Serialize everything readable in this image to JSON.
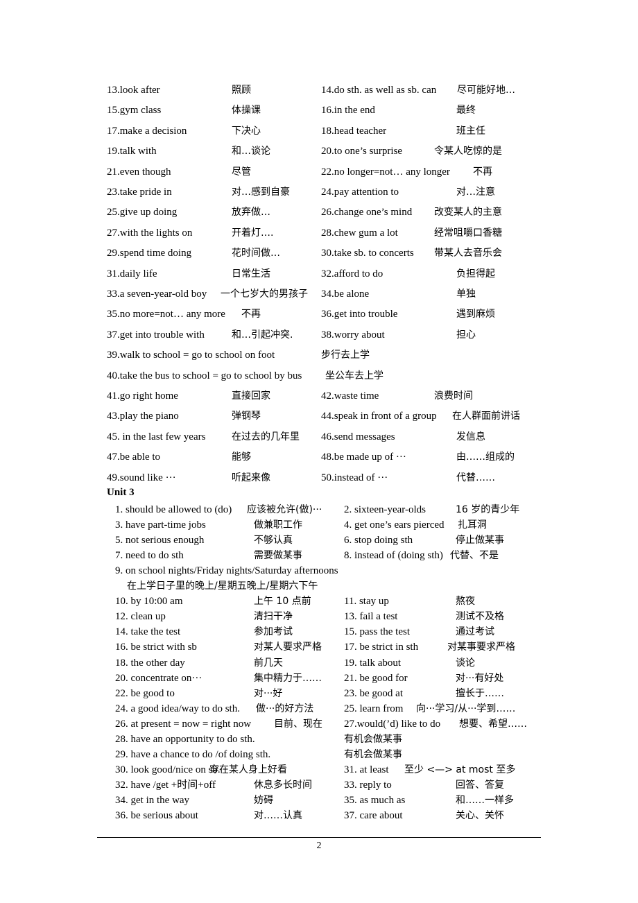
{
  "unit2_continued": [
    {
      "left": {
        "en": "13.look after",
        "zh": "照顾"
      },
      "right": {
        "en": "14.do sth. as well as sb. can",
        "zh": "尽可能好地…"
      }
    },
    {
      "left": {
        "en": "15.gym class",
        "zh": "体操课"
      },
      "right": {
        "en": "16.in the end",
        "zh": "最终"
      }
    },
    {
      "left": {
        "en": "17.make a decision",
        "zh": "下决心"
      },
      "right": {
        "en": "18.head teacher",
        "zh": "班主任"
      }
    },
    {
      "left": {
        "en": "19.talk with",
        "zh": "和…谈论"
      },
      "right": {
        "en": "20.to one’s surprise",
        "zh": "令某人吃惊的是"
      }
    },
    {
      "left": {
        "en": "21.even though",
        "zh": "尽管"
      },
      "right": {
        "en": "22.no longer=not… any longer",
        "zh": "不再"
      }
    },
    {
      "left": {
        "en": "23.take pride in",
        "zh": "对…感到自豪"
      },
      "right": {
        "en": "24.pay attention to",
        "zh": "对…注意"
      }
    },
    {
      "left": {
        "en": "25.give up doing",
        "zh": "放弃做…"
      },
      "right": {
        "en": "26.change one’s mind",
        "zh": "改变某人的主意"
      }
    },
    {
      "left": {
        "en": "27.with the lights on",
        "zh": "开着灯…."
      },
      "right": {
        "en": "28.chew gum a lot",
        "zh": "经常咀嚼口香糖"
      }
    },
    {
      "left": {
        "en": "29.spend time doing",
        "zh": "花时间做…"
      },
      "right": {
        "en": "30.take sb. to concerts",
        "zh": "带某人去音乐会"
      }
    },
    {
      "left": {
        "en": "31.daily life",
        "zh": "日常生活"
      },
      "right": {
        "en": "32.afford to do",
        "zh": "负担得起"
      }
    },
    {
      "left": {
        "en": "33.a seven-year-old boy",
        "zh": "一个七岁大的男孩子"
      },
      "right": {
        "en": "34.be alone",
        "zh": "单独"
      }
    },
    {
      "left": {
        "en": "35.no more=not… any more",
        "zh": "不再"
      },
      "right": {
        "en": "36.get into trouble",
        "zh": "遇到麻烦"
      }
    },
    {
      "left": {
        "en": "37.get into trouble with",
        "zh": "和…引起冲突."
      },
      "right": {
        "en": "38.worry about",
        "zh": "担心"
      }
    },
    {
      "left": {
        "en": "39.walk to school = go to school on foot",
        "zh": "步行去上学"
      },
      "right": null
    },
    {
      "left": {
        "en": "40.take the bus to school = go to school by bus",
        "zh": "坐公车去上学"
      },
      "right": null
    },
    {
      "left": {
        "en": "41.go right home",
        "zh": "直接回家"
      },
      "right": {
        "en": "42.waste time",
        "zh": "浪费时间"
      }
    },
    {
      "left": {
        "en": "43.play the piano",
        "zh": "弹钢琴"
      },
      "right": {
        "en": "44.speak in front of a group",
        "zh": "在人群面前讲话"
      }
    },
    {
      "left": {
        "en": "45. in the last few years",
        "zh": "在过去的几年里"
      },
      "right": {
        "en": "46.send messages",
        "zh": "发信息"
      }
    },
    {
      "left": {
        "en": "47.be able to",
        "zh": "能够"
      },
      "right": {
        "en": "48.be made up of ···",
        "zh": "由……组成的"
      }
    },
    {
      "left": {
        "en": "49.sound like ···",
        "zh": "听起来像"
      },
      "right": {
        "en": "50.instead of ···",
        "zh": "代替……"
      }
    }
  ],
  "unit3": {
    "heading": "Unit 3",
    "rows": [
      {
        "left": {
          "en": "1. should be allowed to (do)",
          "zh": "应该被允许(做)···"
        },
        "right": {
          "en": "2. sixteen-year-olds",
          "zh": "16 岁的青少年"
        }
      },
      {
        "left": {
          "en": "3. have part-time jobs",
          "zh": "做兼职工作"
        },
        "right": {
          "en": "4. get one’s ears pierced",
          "zh": "扎耳洞"
        }
      },
      {
        "left": {
          "en": "5. not serious enough",
          "zh": "不够认真"
        },
        "right": {
          "en": "6. stop doing sth",
          "zh": "停止做某事"
        }
      },
      {
        "left": {
          "en": "7. need to do sth",
          "zh": "需要做某事"
        },
        "right": {
          "en": "8. instead of (doing sth)",
          "zh": "代替、不是"
        }
      },
      {
        "left": {
          "en": "9. on school nights/Friday nights/Saturday afternoons",
          "zh": ""
        },
        "right": null
      },
      {
        "left": {
          "en": "",
          "zh": "在上学日子里的晚上/星期五晚上/星期六下午"
        },
        "right": null
      },
      {
        "left": {
          "en": "10. by 10:00 am",
          "zh": "上午 10 点前"
        },
        "right": {
          "en": "11. stay up",
          "zh": "熬夜"
        }
      },
      {
        "left": {
          "en": "12. clean up",
          "zh": "清扫干净"
        },
        "right": {
          "en": "13. fail a test",
          "zh": "测试不及格"
        }
      },
      {
        "left": {
          "en": "14. take the test",
          "zh": "参加考试"
        },
        "right": {
          "en": "15. pass the test",
          "zh": "通过考试"
        }
      },
      {
        "left": {
          "en": "16. be strict with sb",
          "zh": "对某人要求严格"
        },
        "right": {
          "en": "17. be strict in sth",
          "zh": "对某事要求严格"
        }
      },
      {
        "left": {
          "en": "18. the other day",
          "zh": "前几天"
        },
        "right": {
          "en": "19. talk about",
          "zh": "谈论"
        }
      },
      {
        "left": {
          "en": "20. concentrate on···",
          "zh": "集中精力于……"
        },
        "right": {
          "en": "21. be good for",
          "zh": "对···有好处"
        }
      },
      {
        "left": {
          "en": "22. be good to",
          "zh": "对···好"
        },
        "right": {
          "en": "23. be good at",
          "zh": "擅长于……"
        }
      },
      {
        "left": {
          "en": "24. a good idea/way to do sth.",
          "zh": "做···的好方法"
        },
        "right": {
          "en": "25. learn from",
          "zh": "向···学习/从···学到……"
        }
      },
      {
        "left": {
          "en": "26. at present = now = right now",
          "zh": "目前、现在"
        },
        "right": {
          "en": "27.would(’d) like to do",
          "zh": "想要、希望……"
        }
      },
      {
        "left": {
          "en": "28. have an opportunity to do sth.",
          "zh": ""
        },
        "right": {
          "en": "",
          "zh": "有机会做某事"
        }
      },
      {
        "left": {
          "en": "29. have a chance to do /of doing sth.",
          "zh": ""
        },
        "right": {
          "en": "",
          "zh": "有机会做某事"
        }
      },
      {
        "left": {
          "en": "30. look good/nice on sb.",
          "zh": "穿在某人身上好看"
        },
        "right": {
          "en": "31. at least",
          "zh": "至少 <—> at most 至多"
        }
      },
      {
        "left": {
          "en": "32. have /get +时间+off",
          "zh": "休息多长时间"
        },
        "right": {
          "en": "33. reply to",
          "zh": "回答、答复"
        }
      },
      {
        "left": {
          "en": "34. get in the way",
          "zh": "妨碍"
        },
        "right": {
          "en": "35. as much as",
          "zh": "和……一样多"
        }
      },
      {
        "left": {
          "en": "36. be serious about",
          "zh": "对……认真"
        },
        "right": {
          "en": "37. care about",
          "zh": "关心、关怀"
        }
      }
    ]
  },
  "footer": {
    "page_number": "2"
  }
}
